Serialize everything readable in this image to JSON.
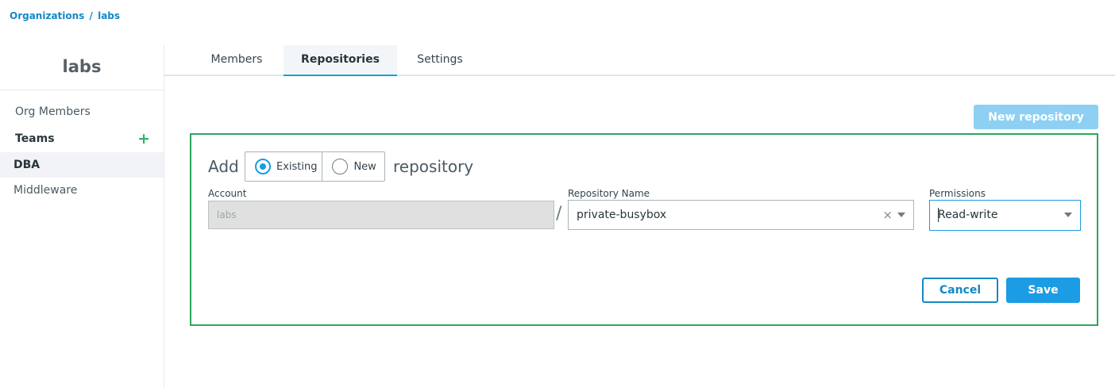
{
  "breadcrumb": {
    "root": "Organizations",
    "separator": "/",
    "current": "labs"
  },
  "sidebar": {
    "org_name": "labs",
    "items": [
      {
        "label": "Org Members"
      },
      {
        "label": "Teams",
        "add_icon": "+"
      },
      {
        "label": "DBA",
        "selected": true
      },
      {
        "label": "Middleware"
      }
    ]
  },
  "tabs": [
    {
      "label": "Members"
    },
    {
      "label": "Repositories",
      "active": true
    },
    {
      "label": "Settings"
    }
  ],
  "new_repository_label": "New repository",
  "form": {
    "add_label": "Add",
    "options": {
      "existing": "Existing",
      "new": "New",
      "selected": "existing"
    },
    "repository_label": "repository",
    "account": {
      "label": "Account",
      "value": "labs"
    },
    "slash": "/",
    "repository_name": {
      "label": "Repository Name",
      "value": "private-busybox",
      "clear_icon": "×"
    },
    "permissions": {
      "label": "Permissions",
      "value": "Read-write"
    },
    "cancel_label": "Cancel",
    "save_label": "Save"
  },
  "colors": {
    "accent": "#1b9ce5",
    "panel_border": "#2ea55f",
    "add_icon": "#2fb36b"
  }
}
